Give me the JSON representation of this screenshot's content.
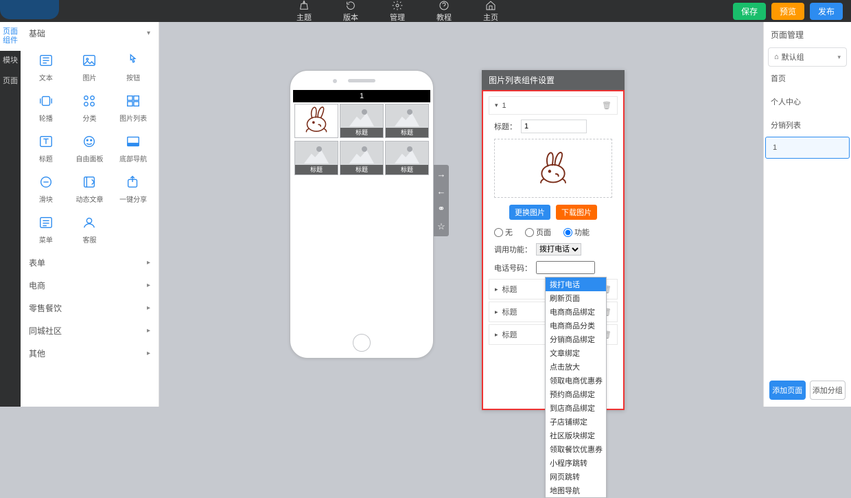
{
  "topbar": {
    "icons": [
      {
        "label": "主题",
        "name": "theme-icon"
      },
      {
        "label": "版本",
        "name": "version-icon"
      },
      {
        "label": "管理",
        "name": "manage-icon"
      },
      {
        "label": "教程",
        "name": "tutorial-icon"
      },
      {
        "label": "主页",
        "name": "home-icon"
      }
    ],
    "save": "保存",
    "preview": "预览",
    "publish": "发布"
  },
  "left_tabs": [
    "页面组件",
    "模块",
    "页面"
  ],
  "accordion_basic": "基础",
  "widgets": [
    {
      "label": "文本",
      "name": "text-widget"
    },
    {
      "label": "图片",
      "name": "image-widget"
    },
    {
      "label": "按钮",
      "name": "button-widget"
    },
    {
      "label": "轮播",
      "name": "carousel-widget"
    },
    {
      "label": "分类",
      "name": "category-widget"
    },
    {
      "label": "图片列表",
      "name": "imagelist-widget"
    },
    {
      "label": "标题",
      "name": "title-widget"
    },
    {
      "label": "自由面板",
      "name": "freepanel-widget"
    },
    {
      "label": "底部导航",
      "name": "bottomnav-widget"
    },
    {
      "label": "滑块",
      "name": "slider-widget"
    },
    {
      "label": "动态文章",
      "name": "article-widget"
    },
    {
      "label": "一键分享",
      "name": "share-widget"
    },
    {
      "label": "菜单",
      "name": "menu-widget"
    },
    {
      "label": "客服",
      "name": "service-widget"
    }
  ],
  "accordion_others": [
    "表单",
    "电商",
    "零售餐饮",
    "同城社区",
    "其他"
  ],
  "phone": {
    "page_bar": "1",
    "thumb_label": "标题"
  },
  "popup": {
    "title": "图片列表组件设置",
    "item_num": "1",
    "label_title": "标题：",
    "title_val": "1",
    "btn_replace": "更换图片",
    "btn_download": "下载图片",
    "link_none": "无",
    "link_page": "页面",
    "link_func": "功能",
    "func_label": "调用功能：",
    "func_selected": "拨打电话",
    "phone_label": "电话号码：",
    "collapsed_label": "标题",
    "dropdown": [
      "拨打电话",
      "刷新页面",
      "电商商品绑定",
      "电商商品分类",
      "分销商品绑定",
      "文章绑定",
      "点击放大",
      "领取电商优惠券",
      "预约商品绑定",
      "到店商品绑定",
      "子店铺绑定",
      "社区版块绑定",
      "领取餐饮优惠券",
      "小程序跳转",
      "网页跳转",
      "地图导航"
    ]
  },
  "right": {
    "head": "页面管理",
    "group": "默认组",
    "pages": [
      "首页",
      "个人中心",
      "分销列表",
      "1"
    ],
    "add_page": "添加页面",
    "add_group": "添加分组"
  }
}
